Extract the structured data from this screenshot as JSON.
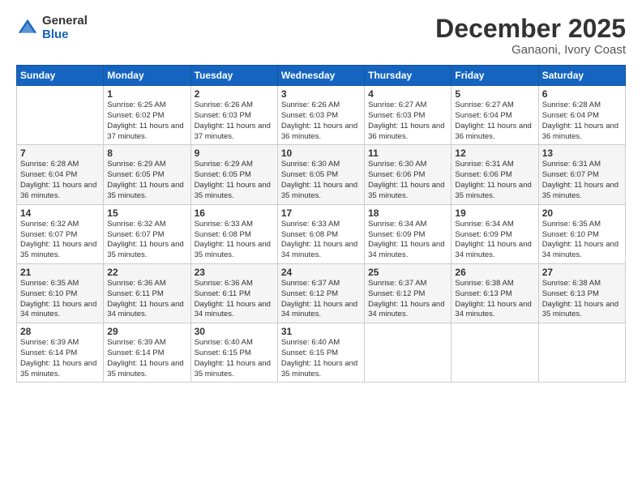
{
  "logo": {
    "general": "General",
    "blue": "Blue"
  },
  "header": {
    "month": "December 2025",
    "location": "Ganaoni, Ivory Coast"
  },
  "weekdays": [
    "Sunday",
    "Monday",
    "Tuesday",
    "Wednesday",
    "Thursday",
    "Friday",
    "Saturday"
  ],
  "weeks": [
    [
      {
        "day": "",
        "sunrise": "",
        "sunset": "",
        "daylight": ""
      },
      {
        "day": "1",
        "sunrise": "Sunrise: 6:25 AM",
        "sunset": "Sunset: 6:02 PM",
        "daylight": "Daylight: 11 hours and 37 minutes."
      },
      {
        "day": "2",
        "sunrise": "Sunrise: 6:26 AM",
        "sunset": "Sunset: 6:03 PM",
        "daylight": "Daylight: 11 hours and 37 minutes."
      },
      {
        "day": "3",
        "sunrise": "Sunrise: 6:26 AM",
        "sunset": "Sunset: 6:03 PM",
        "daylight": "Daylight: 11 hours and 36 minutes."
      },
      {
        "day": "4",
        "sunrise": "Sunrise: 6:27 AM",
        "sunset": "Sunset: 6:03 PM",
        "daylight": "Daylight: 11 hours and 36 minutes."
      },
      {
        "day": "5",
        "sunrise": "Sunrise: 6:27 AM",
        "sunset": "Sunset: 6:04 PM",
        "daylight": "Daylight: 11 hours and 36 minutes."
      },
      {
        "day": "6",
        "sunrise": "Sunrise: 6:28 AM",
        "sunset": "Sunset: 6:04 PM",
        "daylight": "Daylight: 11 hours and 36 minutes."
      }
    ],
    [
      {
        "day": "7",
        "sunrise": "Sunrise: 6:28 AM",
        "sunset": "Sunset: 6:04 PM",
        "daylight": "Daylight: 11 hours and 36 minutes."
      },
      {
        "day": "8",
        "sunrise": "Sunrise: 6:29 AM",
        "sunset": "Sunset: 6:05 PM",
        "daylight": "Daylight: 11 hours and 35 minutes."
      },
      {
        "day": "9",
        "sunrise": "Sunrise: 6:29 AM",
        "sunset": "Sunset: 6:05 PM",
        "daylight": "Daylight: 11 hours and 35 minutes."
      },
      {
        "day": "10",
        "sunrise": "Sunrise: 6:30 AM",
        "sunset": "Sunset: 6:05 PM",
        "daylight": "Daylight: 11 hours and 35 minutes."
      },
      {
        "day": "11",
        "sunrise": "Sunrise: 6:30 AM",
        "sunset": "Sunset: 6:06 PM",
        "daylight": "Daylight: 11 hours and 35 minutes."
      },
      {
        "day": "12",
        "sunrise": "Sunrise: 6:31 AM",
        "sunset": "Sunset: 6:06 PM",
        "daylight": "Daylight: 11 hours and 35 minutes."
      },
      {
        "day": "13",
        "sunrise": "Sunrise: 6:31 AM",
        "sunset": "Sunset: 6:07 PM",
        "daylight": "Daylight: 11 hours and 35 minutes."
      }
    ],
    [
      {
        "day": "14",
        "sunrise": "Sunrise: 6:32 AM",
        "sunset": "Sunset: 6:07 PM",
        "daylight": "Daylight: 11 hours and 35 minutes."
      },
      {
        "day": "15",
        "sunrise": "Sunrise: 6:32 AM",
        "sunset": "Sunset: 6:07 PM",
        "daylight": "Daylight: 11 hours and 35 minutes."
      },
      {
        "day": "16",
        "sunrise": "Sunrise: 6:33 AM",
        "sunset": "Sunset: 6:08 PM",
        "daylight": "Daylight: 11 hours and 35 minutes."
      },
      {
        "day": "17",
        "sunrise": "Sunrise: 6:33 AM",
        "sunset": "Sunset: 6:08 PM",
        "daylight": "Daylight: 11 hours and 34 minutes."
      },
      {
        "day": "18",
        "sunrise": "Sunrise: 6:34 AM",
        "sunset": "Sunset: 6:09 PM",
        "daylight": "Daylight: 11 hours and 34 minutes."
      },
      {
        "day": "19",
        "sunrise": "Sunrise: 6:34 AM",
        "sunset": "Sunset: 6:09 PM",
        "daylight": "Daylight: 11 hours and 34 minutes."
      },
      {
        "day": "20",
        "sunrise": "Sunrise: 6:35 AM",
        "sunset": "Sunset: 6:10 PM",
        "daylight": "Daylight: 11 hours and 34 minutes."
      }
    ],
    [
      {
        "day": "21",
        "sunrise": "Sunrise: 6:35 AM",
        "sunset": "Sunset: 6:10 PM",
        "daylight": "Daylight: 11 hours and 34 minutes."
      },
      {
        "day": "22",
        "sunrise": "Sunrise: 6:36 AM",
        "sunset": "Sunset: 6:11 PM",
        "daylight": "Daylight: 11 hours and 34 minutes."
      },
      {
        "day": "23",
        "sunrise": "Sunrise: 6:36 AM",
        "sunset": "Sunset: 6:11 PM",
        "daylight": "Daylight: 11 hours and 34 minutes."
      },
      {
        "day": "24",
        "sunrise": "Sunrise: 6:37 AM",
        "sunset": "Sunset: 6:12 PM",
        "daylight": "Daylight: 11 hours and 34 minutes."
      },
      {
        "day": "25",
        "sunrise": "Sunrise: 6:37 AM",
        "sunset": "Sunset: 6:12 PM",
        "daylight": "Daylight: 11 hours and 34 minutes."
      },
      {
        "day": "26",
        "sunrise": "Sunrise: 6:38 AM",
        "sunset": "Sunset: 6:13 PM",
        "daylight": "Daylight: 11 hours and 34 minutes."
      },
      {
        "day": "27",
        "sunrise": "Sunrise: 6:38 AM",
        "sunset": "Sunset: 6:13 PM",
        "daylight": "Daylight: 11 hours and 35 minutes."
      }
    ],
    [
      {
        "day": "28",
        "sunrise": "Sunrise: 6:39 AM",
        "sunset": "Sunset: 6:14 PM",
        "daylight": "Daylight: 11 hours and 35 minutes."
      },
      {
        "day": "29",
        "sunrise": "Sunrise: 6:39 AM",
        "sunset": "Sunset: 6:14 PM",
        "daylight": "Daylight: 11 hours and 35 minutes."
      },
      {
        "day": "30",
        "sunrise": "Sunrise: 6:40 AM",
        "sunset": "Sunset: 6:15 PM",
        "daylight": "Daylight: 11 hours and 35 minutes."
      },
      {
        "day": "31",
        "sunrise": "Sunrise: 6:40 AM",
        "sunset": "Sunset: 6:15 PM",
        "daylight": "Daylight: 11 hours and 35 minutes."
      },
      {
        "day": "",
        "sunrise": "",
        "sunset": "",
        "daylight": ""
      },
      {
        "day": "",
        "sunrise": "",
        "sunset": "",
        "daylight": ""
      },
      {
        "day": "",
        "sunrise": "",
        "sunset": "",
        "daylight": ""
      }
    ]
  ]
}
